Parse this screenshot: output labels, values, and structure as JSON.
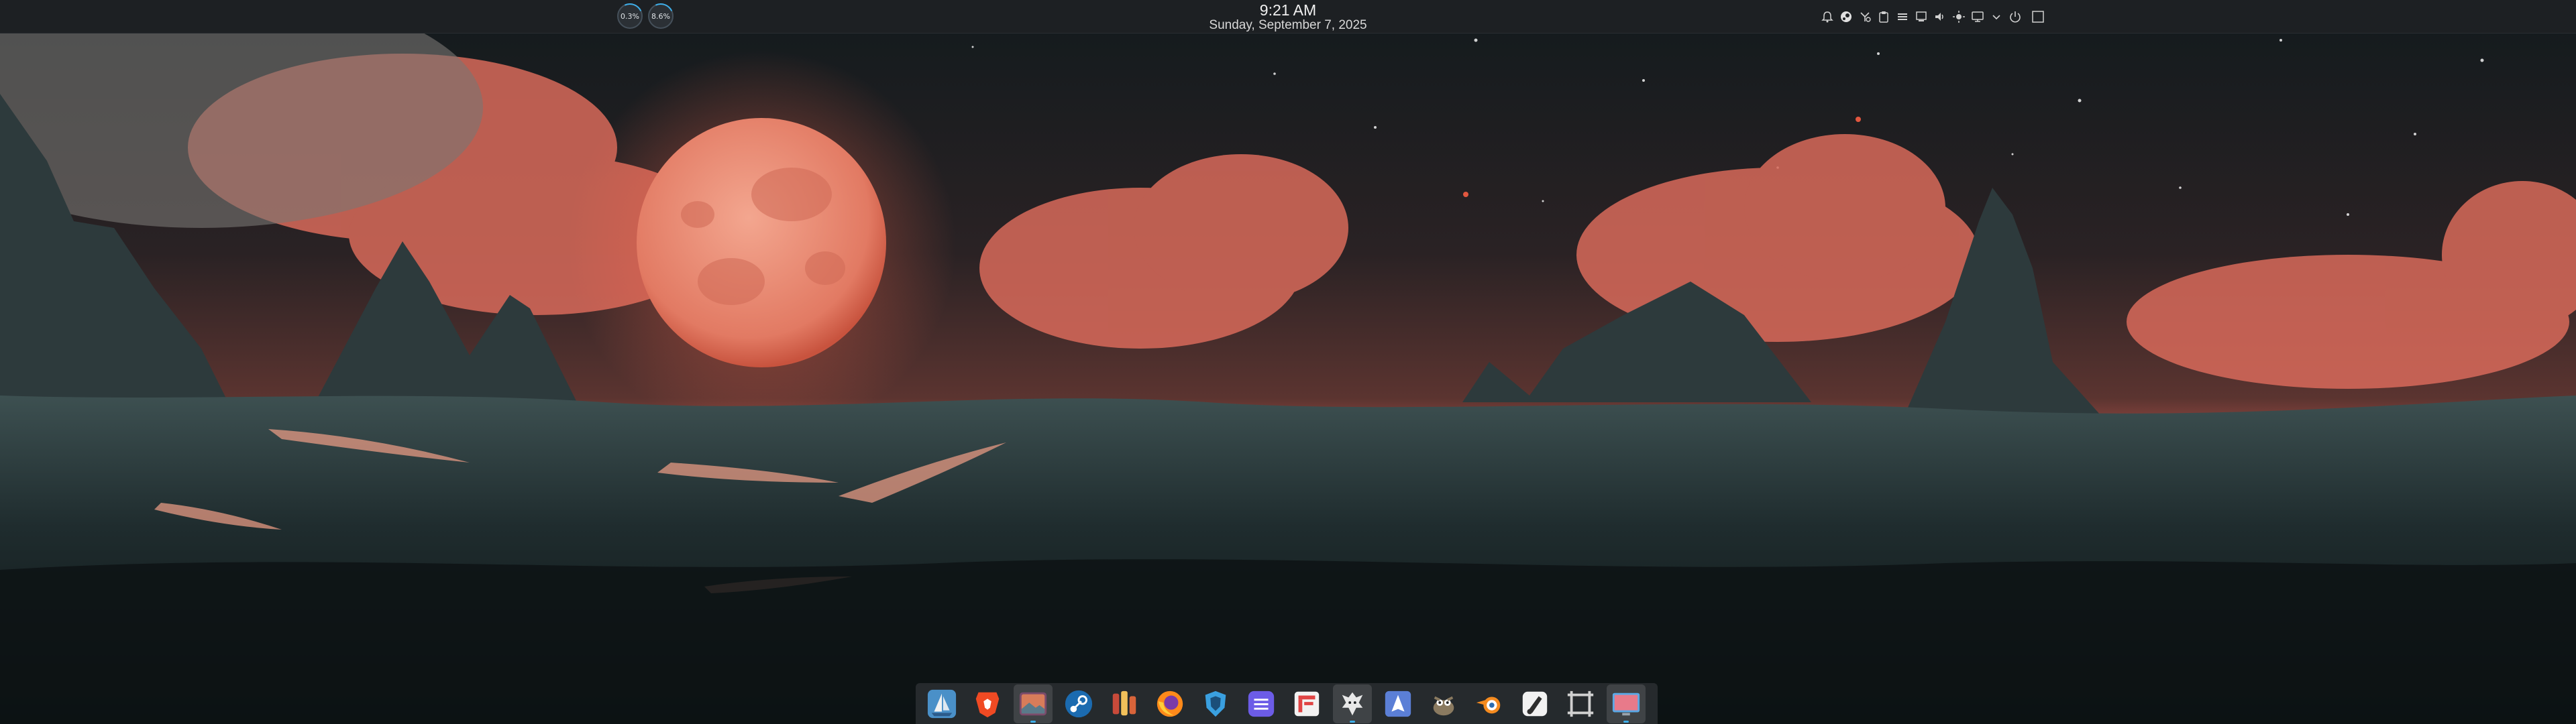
{
  "panel": {
    "monitors": [
      {
        "name": "cpu-monitor",
        "value": "0.3%"
      },
      {
        "name": "memory-monitor",
        "value": "8.6%"
      }
    ],
    "clock": {
      "time": "9:21 AM",
      "date": "Sunday, September 7, 2025"
    },
    "tray_icons": [
      "notifications-icon",
      "steam-tray-icon",
      "keyboard-icon",
      "clipboard-icon",
      "menu-icon",
      "network-icon",
      "volume-icon",
      "brightness-icon",
      "display-icon",
      "expand-tray-icon",
      "power-icon",
      "show-desktop-icon"
    ]
  },
  "dock": {
    "apps": [
      {
        "name": "dolphin-file-manager",
        "icon": "sailboat-icon",
        "color": "#4a90c8"
      },
      {
        "name": "brave-browser",
        "icon": "lion-shield-icon",
        "color": "#f04a23"
      },
      {
        "name": "image-viewer",
        "icon": "picture-icon",
        "color": "#c05a5a"
      },
      {
        "name": "steam",
        "icon": "steam-icon",
        "color": "#1b6bb0"
      },
      {
        "name": "app-launcher",
        "icon": "rocket-icon",
        "color": "#d8643a"
      },
      {
        "name": "firefox",
        "icon": "firefox-icon",
        "color": "#ff8a1a"
      },
      {
        "name": "protonvpn",
        "icon": "shield-icon",
        "color": "#3aa0e0"
      },
      {
        "name": "element-chat",
        "icon": "chat-icon",
        "color": "#6c5ce7"
      },
      {
        "name": "flatseal",
        "icon": "flag-icon",
        "color": "#e04444"
      },
      {
        "name": "discover",
        "icon": "dragon-icon",
        "color": "#e8e8e8"
      },
      {
        "name": "inkscape",
        "icon": "pen-icon",
        "color": "#5b7fd6"
      },
      {
        "name": "gimp",
        "icon": "wilber-icon",
        "color": "#8a7a60"
      },
      {
        "name": "blender",
        "icon": "blender-icon",
        "color": "#f58b1f"
      },
      {
        "name": "krita",
        "icon": "brush-icon",
        "color": "#2e2e2e"
      },
      {
        "name": "screenshot-tool",
        "icon": "crop-frame-icon",
        "color": "#d0d0d0"
      },
      {
        "name": "system-monitor",
        "icon": "monitor-icon",
        "color": "#5aa9e6"
      }
    ],
    "active_indices": [
      2,
      9,
      15
    ]
  }
}
